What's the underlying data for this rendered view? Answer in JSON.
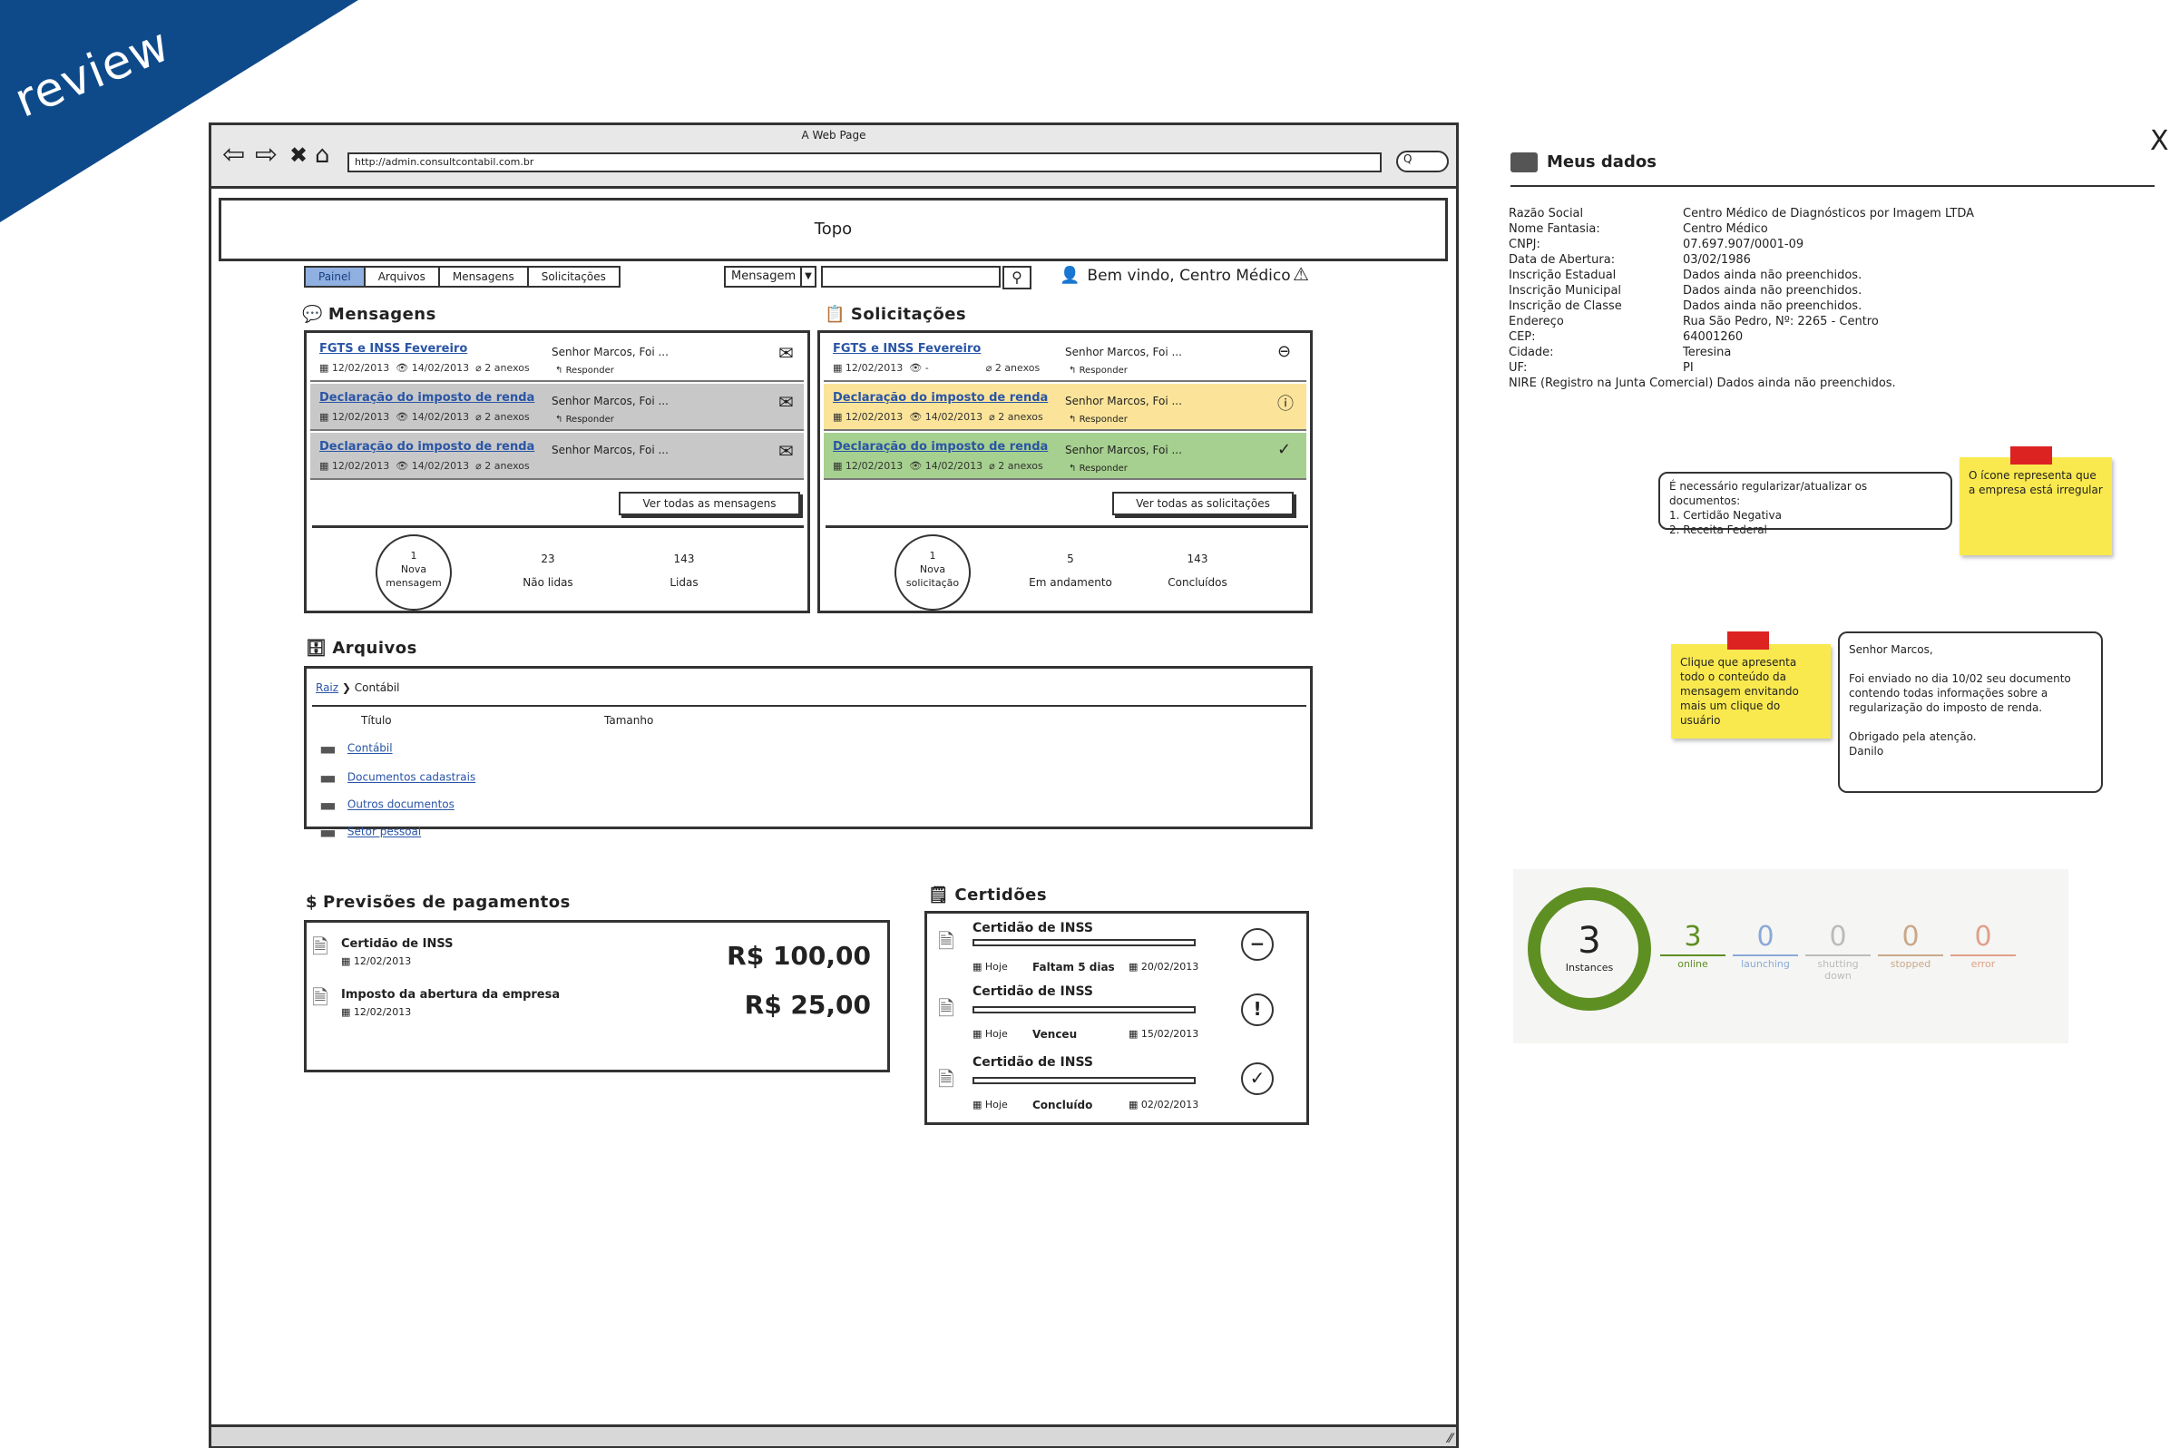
{
  "ribbon": {
    "text": "review"
  },
  "browser": {
    "window_title": "A Web Page",
    "url": "http://admin.consultcontabil.com.br",
    "search_pill": "Q",
    "topo": "Topo"
  },
  "nav": {
    "tabs": [
      "Painel",
      "Arquivos",
      "Mensagens",
      "Solicitações"
    ],
    "search_select": "Mensagem",
    "welcome": "Bem vindo, Centro Médico"
  },
  "mensagens": {
    "title": "Mensagens",
    "items": [
      {
        "title": "FGTS e INSS Fevereiro",
        "date1": "12/02/2013",
        "date2": "14/02/2013",
        "attachments": "2 anexos",
        "from": "Senhor Marcos, Foi ...",
        "reply": "Responder",
        "icon": "envelope-icon"
      },
      {
        "title": "Declaração do imposto de renda",
        "date1": "12/02/2013",
        "date2": "14/02/2013",
        "attachments": "2 anexos",
        "from": "Senhor Marcos, Foi ...",
        "reply": "Responder",
        "icon": "envelope-open-icon"
      },
      {
        "title": "Declaração do imposto de renda",
        "date1": "12/02/2013",
        "date2": "14/02/2013",
        "attachments": "2 anexos",
        "from": "Senhor Marcos, Foi ...",
        "reply": "",
        "icon": "envelope-open-icon"
      }
    ],
    "ver_todas": "Ver todas as mensagens",
    "circle": "1\nNova\nmensagem",
    "stats": [
      {
        "n": "23",
        "label": "Não lidas"
      },
      {
        "n": "143",
        "label": "Lidas"
      }
    ]
  },
  "solicitacoes": {
    "title": "Solicitações",
    "items": [
      {
        "title": "FGTS e INSS Fevereiro",
        "date1": "12/02/2013",
        "date2": "-",
        "attachments": "2 anexos",
        "from": "Senhor Marcos, Foi ...",
        "reply": "Responder",
        "status": "pending",
        "bg": "#ffffff"
      },
      {
        "title": "Declaração do imposto de renda",
        "date1": "12/02/2013",
        "date2": "14/02/2013",
        "attachments": "2 anexos",
        "from": "Senhor Marcos, Foi ...",
        "reply": "Responder",
        "status": "warning",
        "bg": "#fbe49a"
      },
      {
        "title": "Declaração do imposto de renda",
        "date1": "12/02/2013",
        "date2": "14/02/2013",
        "attachments": "2 anexos",
        "from": "Senhor Marcos, Foi ...",
        "reply": "Responder",
        "status": "done",
        "bg": "#a6d08f"
      }
    ],
    "ver_todas": "Ver todas as solicitações",
    "circle": "1\nNova\nsolicitação",
    "stats": [
      {
        "n": "5",
        "label": "Em andamento"
      },
      {
        "n": "143",
        "label": "Concluídos"
      }
    ]
  },
  "arquivos": {
    "title": "Arquivos",
    "breadcrumb_root": "Raiz",
    "breadcrumb_current": "Contábil",
    "col_titulo": "Título",
    "col_tamanho": "Tamanho",
    "folders": [
      "Contábil",
      "Documentos cadastrais",
      "Outros documentos",
      "Setor pessoal"
    ]
  },
  "previsoes": {
    "title": "Previsões de pagamentos",
    "items": [
      {
        "title": "Certidão de INSS",
        "date": "12/02/2013",
        "value": "R$ 100,00"
      },
      {
        "title": "Imposto da abertura da empresa",
        "date": "12/02/2013",
        "value": "R$ 25,00"
      }
    ]
  },
  "certidoes": {
    "title": "Certidões",
    "items": [
      {
        "title": "Certidão de INSS",
        "hoje": "Hoje",
        "status": "Faltam 5 dias",
        "date": "20/02/2013",
        "icon": "minus-circle-icon",
        "glyph": "−"
      },
      {
        "title": "Certidão de INSS",
        "hoje": "Hoje",
        "status": "Venceu",
        "date": "15/02/2013",
        "icon": "exclamation-circle-icon",
        "glyph": "!"
      },
      {
        "title": "Certidão de INSS",
        "hoje": "Hoje",
        "status": "Concluído",
        "date": "02/02/2013",
        "icon": "check-circle-icon",
        "glyph": "✓"
      }
    ]
  },
  "meus_dados": {
    "title": "Meus dados",
    "close": "X",
    "fields": [
      {
        "k": "Razão Social",
        "v": "Centro Médico de Diagnósticos por Imagem LTDA"
      },
      {
        "k": "Nome Fantasia:",
        "v": "Centro Médico"
      },
      {
        "k": "CNPJ:",
        "v": "07.697.907/0001-09"
      },
      {
        "k": "Data de Abertura:",
        "v": "03/02/1986"
      },
      {
        "k": "Inscrição Estadual",
        "v": "Dados ainda não preenchidos."
      },
      {
        "k": "Inscrição Municipal",
        "v": "Dados ainda não preenchidos."
      },
      {
        "k": "Inscrição de Classe",
        "v": "Dados ainda não preenchidos."
      },
      {
        "k": "Endereço",
        "v": "Rua São Pedro, Nº: 2265   -   Centro"
      },
      {
        "k": "CEP:",
        "v": "64001260"
      },
      {
        "k": "Cidade:",
        "v": "Teresina"
      },
      {
        "k": "UF:",
        "v": "PI"
      }
    ],
    "nire": "NIRE (Registro na Junta Comercial)   Dados ainda não preenchidos."
  },
  "notes": {
    "bubble1": "É necessário regularizar/atualizar os documentos:\n1. Certidão Negativa\n2. Receita Federal",
    "sticky1": "O ícone representa que a empresa está irregular",
    "sticky2": "Clique que apresenta todo o conteúdo da mensagem envitando mais um clique do usuário",
    "bubble2": "Senhor Marcos,\n\nFoi enviado no dia 10/02 seu documento contendo todas informações sobre a regularização do imposto de renda.\n\nObrigado pela atenção.\nDanilo"
  },
  "instances": {
    "total": "3",
    "total_label": "Instances",
    "stats": [
      {
        "n": "3",
        "label": "online",
        "color": "#5e8f22"
      },
      {
        "n": "0",
        "label": "launching",
        "color": "#8aa9d8"
      },
      {
        "n": "0",
        "label": "shutting down",
        "color": "#bbbbbb"
      },
      {
        "n": "0",
        "label": "stopped",
        "color": "#c9a98a"
      },
      {
        "n": "0",
        "label": "error",
        "color": "#e0a08a"
      }
    ]
  }
}
